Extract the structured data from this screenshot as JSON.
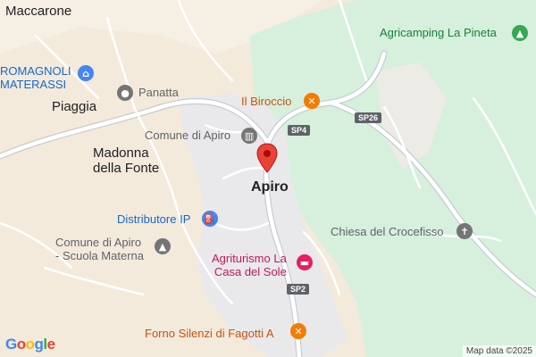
{
  "map": {
    "labels": {
      "maccarone": "Maccarone",
      "romagnoli_1": "ROMAGNOLI",
      "romagnoli_2": "MATERASSI",
      "panatta": "Panatta",
      "piaggia": "Piaggia",
      "madonna_1": "Madonna",
      "madonna_2": "della Fonte",
      "comune": "Comune di Apiro",
      "apiro": "Apiro",
      "il_biroccio": "Il Biroccio",
      "distributore": "Distributore IP",
      "scuola_1": "Comune di Apiro",
      "scuola_2": "- Scuola Materna",
      "agriturismo_1": "Agriturismo La",
      "agriturismo_2": "Casa del Sole",
      "forno": "Forno Silenzi di Fagotti A",
      "chiesa": "Chiesa del Crocefisso",
      "agricamping": "Agricamping La Pineta"
    },
    "road_shields": {
      "sp4": "SP4",
      "sp26": "SP26",
      "sp2": "SP2"
    },
    "icons": {
      "shopping": "shopping-bag-icon",
      "camera": "camera-icon",
      "museum": "museum-icon",
      "restaurant": "restaurant-icon",
      "fuel": "fuel-icon",
      "school": "school-icon",
      "hotel": "hotel-icon",
      "church": "church-icon",
      "camping": "camping-icon",
      "pin": "location-pin-icon"
    },
    "attribution": "Map data ©2025",
    "logo": "Google",
    "colors": {
      "land": "#f3eadb",
      "forest": "#d6f0dd",
      "urban": "#e9e9ec",
      "road": "#ffffff",
      "road_casing": "#b5bdc7",
      "pin_red": "#ea4335",
      "restaurant_orange": "#f57c00",
      "hotel_pink": "#e91e63",
      "fuel_blue": "#4285f4",
      "poi_gray": "#757575",
      "camping_green": "#34a853"
    }
  }
}
